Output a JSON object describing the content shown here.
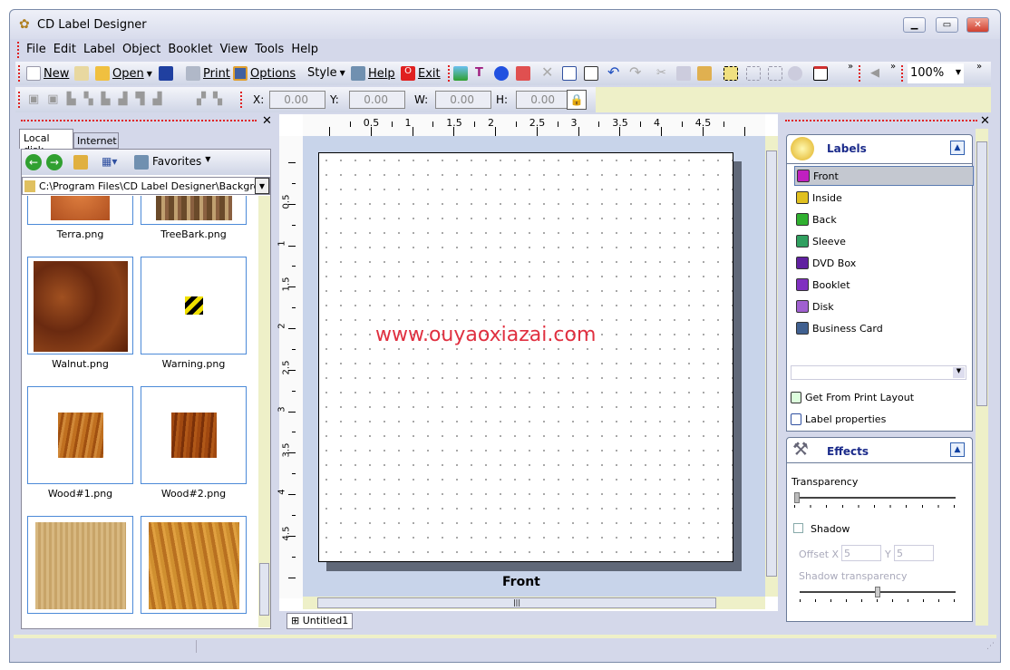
{
  "app": {
    "title": "CD Label Designer"
  },
  "menu": [
    "File",
    "Edit",
    "Label",
    "Object",
    "Booklet",
    "View",
    "Tools",
    "Help"
  ],
  "toolbar": {
    "new": "New",
    "open": "Open",
    "print": "Print",
    "options": "Options",
    "style": "Style",
    "help": "Help",
    "exit": "Exit",
    "zoom": "100%"
  },
  "position": {
    "x_label": "X:",
    "x": "0.00",
    "y_label": "Y:",
    "y": "0.00",
    "w_label": "W:",
    "w": "0.00",
    "h_label": "H:",
    "h": "0.00"
  },
  "left_panel": {
    "tabs": [
      "Local disk",
      "Internet"
    ],
    "favorites": "Favorites",
    "path": "C:\\Program Files\\CD Label Designer\\Backgrounds",
    "files": [
      "Terra.png",
      "TreeBark.png",
      "Walnut.png",
      "Warning.png",
      "Wood#1.png",
      "Wood#2.png"
    ]
  },
  "ruler": {
    "h": [
      "0.5",
      "1",
      "1.5",
      "2",
      "2.5",
      "3",
      "3.5",
      "4",
      "4.5"
    ],
    "v": [
      "0.5",
      "1",
      "1.5",
      "2",
      "2.5",
      "3",
      "3.5",
      "4",
      "4.5"
    ]
  },
  "canvas": {
    "label_name": "Front",
    "watermark": "www.ouyaoxiazai.com"
  },
  "doc_tabs": [
    "Untitled1"
  ],
  "labels_group": {
    "title": "Labels",
    "items": [
      {
        "label": "Front",
        "icon": "front-label-icon",
        "color": "#c020c0",
        "selected": true
      },
      {
        "label": "Inside",
        "icon": "inside-label-icon",
        "color": "#e0c020"
      },
      {
        "label": "Back",
        "icon": "back-label-icon",
        "color": "#30b030"
      },
      {
        "label": "Sleeve",
        "icon": "sleeve-label-icon",
        "color": "#30a060"
      },
      {
        "label": "DVD Box",
        "icon": "dvd-box-icon",
        "color": "#6020a0"
      },
      {
        "label": "Booklet",
        "icon": "booklet-icon",
        "color": "#8030c0"
      },
      {
        "label": "Disk",
        "icon": "disk-icon",
        "color": "#a060d0"
      },
      {
        "label": "Business Card",
        "icon": "business-card-icon",
        "color": "#406090"
      }
    ],
    "get_from_print": "Get From Print Layout",
    "label_properties": "Label properties"
  },
  "effects_group": {
    "title": "Effects",
    "transparency_label": "Transparency",
    "transparency": 0,
    "shadow_label": "Shadow",
    "shadow_checked": false,
    "offset_x_label": "Offset X",
    "offset_x": "5",
    "offset_y_label": "Y",
    "offset_y": "5",
    "shadow_transparency_label": "Shadow transparency",
    "shadow_transparency": 50
  }
}
